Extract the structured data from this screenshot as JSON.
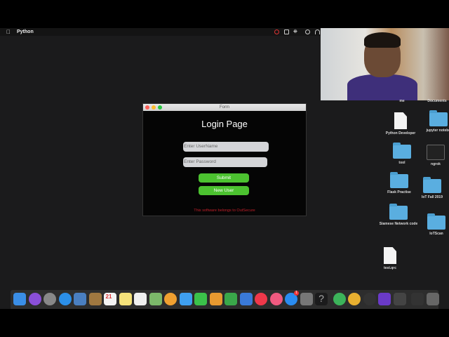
{
  "menubar": {
    "app_name": "Python",
    "status_icons": [
      "screen-record-icon",
      "airplay-icon",
      "bluetooth-icon",
      "time-machine-icon",
      "wifi-icon"
    ]
  },
  "window": {
    "title": "Form",
    "heading": "Login Page",
    "username_placeholder": "Enter UserName",
    "password_placeholder": "Enter Password",
    "submit_label": "Submit",
    "new_user_label": "New User",
    "footer": "This software belongs to OutSecure",
    "accent": "#4cc230",
    "footer_color": "#c0202a"
  },
  "desktop": {
    "items": [
      {
        "label": "me",
        "type": "none"
      },
      {
        "label": "Documents",
        "type": "none"
      },
      {
        "label": "Python Developer",
        "type": "doc"
      },
      {
        "label": "jupyter notebo",
        "type": "folder"
      },
      {
        "label": "tool",
        "type": "folder"
      },
      {
        "label": "ngrok",
        "type": "terminal"
      },
      {
        "label": "Flask Practise",
        "type": "folder"
      },
      {
        "label": "IoT Fall 2019",
        "type": "folder"
      },
      {
        "label": "Siamese Network code",
        "type": "folder"
      },
      {
        "label": "IoTScan",
        "type": "folder"
      },
      {
        "label": "test.qrc",
        "type": "doc"
      }
    ]
  },
  "dock": {
    "app_store_badge": "1",
    "calendar_day": "21",
    "items": [
      {
        "name": "finder",
        "color": "#3a8ee6"
      },
      {
        "name": "siri",
        "color": "#8a4fd8"
      },
      {
        "name": "launchpad",
        "color": "#888"
      },
      {
        "name": "safari",
        "color": "#2b8fe8"
      },
      {
        "name": "preview",
        "color": "#4a7fc0"
      },
      {
        "name": "contacts",
        "color": "#a07840"
      },
      {
        "name": "calendar",
        "color": "#f4f4f4"
      },
      {
        "name": "notes",
        "color": "#f5e27a"
      },
      {
        "name": "reminders",
        "color": "#f0f0f0"
      },
      {
        "name": "maps",
        "color": "#7cb86a"
      },
      {
        "name": "photos",
        "color": "#f0a030"
      },
      {
        "name": "messages",
        "color": "#3fa0f0"
      },
      {
        "name": "facetime",
        "color": "#3bc24a"
      },
      {
        "name": "pages",
        "color": "#e89a30"
      },
      {
        "name": "numbers",
        "color": "#3aa84a"
      },
      {
        "name": "keynote",
        "color": "#3a7ad8"
      },
      {
        "name": "news",
        "color": "#f0384a"
      },
      {
        "name": "music",
        "color": "#f05a80"
      },
      {
        "name": "app-store",
        "color": "#2a8cf0"
      },
      {
        "name": "system-preferences",
        "color": "#777"
      },
      {
        "name": "help",
        "color": "#1b1b1c"
      },
      {
        "name": "pycharm",
        "color": "#3cb35a"
      },
      {
        "name": "chrome",
        "color": "#e8b030"
      },
      {
        "name": "obs",
        "color": "#333"
      },
      {
        "name": "intellij",
        "color": "#6a3ac8"
      },
      {
        "name": "python-launcher",
        "color": "#444"
      },
      {
        "name": "minimized-window",
        "color": "#333"
      },
      {
        "name": "trash",
        "color": "#666"
      }
    ]
  }
}
